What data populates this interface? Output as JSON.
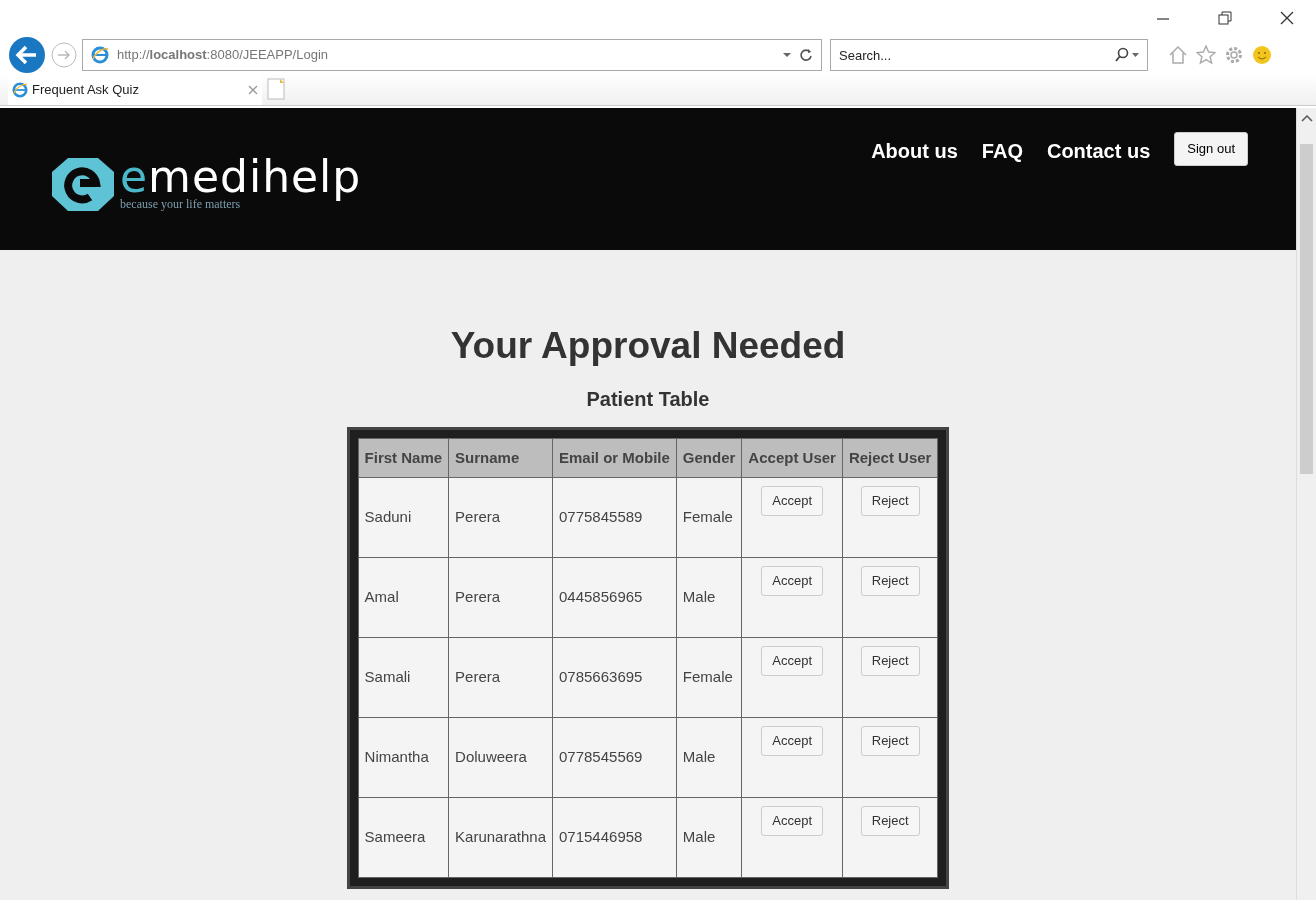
{
  "browser": {
    "url": "http://**localhost**:8080/JEEAPP/Login",
    "search": {
      "placeholder": "Search..."
    },
    "tab": {
      "title": "Frequent Ask Quiz"
    }
  },
  "header": {
    "logo": {
      "prefix": "e",
      "name": "medihelp",
      "tagline": "because your life matters"
    },
    "nav": [
      {
        "label": "About us"
      },
      {
        "label": "FAQ"
      },
      {
        "label": "Contact us"
      }
    ],
    "sign_out": "Sign out"
  },
  "heading": "Your Approval Needed",
  "table": {
    "caption": "Patient Table",
    "columns": [
      "First Name",
      "Surname",
      "Email or Mobile",
      "Gender",
      "Accept User",
      "Reject User"
    ],
    "rows": [
      {
        "first_name": "Saduni",
        "surname": "Perera",
        "contact": "0775845589",
        "gender": "Female",
        "accept": "Accept",
        "reject": "Reject"
      },
      {
        "first_name": "Amal",
        "surname": "Perera",
        "contact": "0445856965",
        "gender": "Male",
        "accept": "Accept",
        "reject": "Reject"
      },
      {
        "first_name": "Samali",
        "surname": "Perera",
        "contact": "0785663695",
        "gender": "Female",
        "accept": "Accept",
        "reject": "Reject"
      },
      {
        "first_name": "Nimantha",
        "surname": "Doluweera",
        "contact": "0778545569",
        "gender": "Male",
        "accept": "Accept",
        "reject": "Reject"
      },
      {
        "first_name": "Sameera",
        "surname": "Karunarathna",
        "contact": "0715446958",
        "gender": "Male",
        "accept": "Accept",
        "reject": "Reject"
      }
    ]
  }
}
